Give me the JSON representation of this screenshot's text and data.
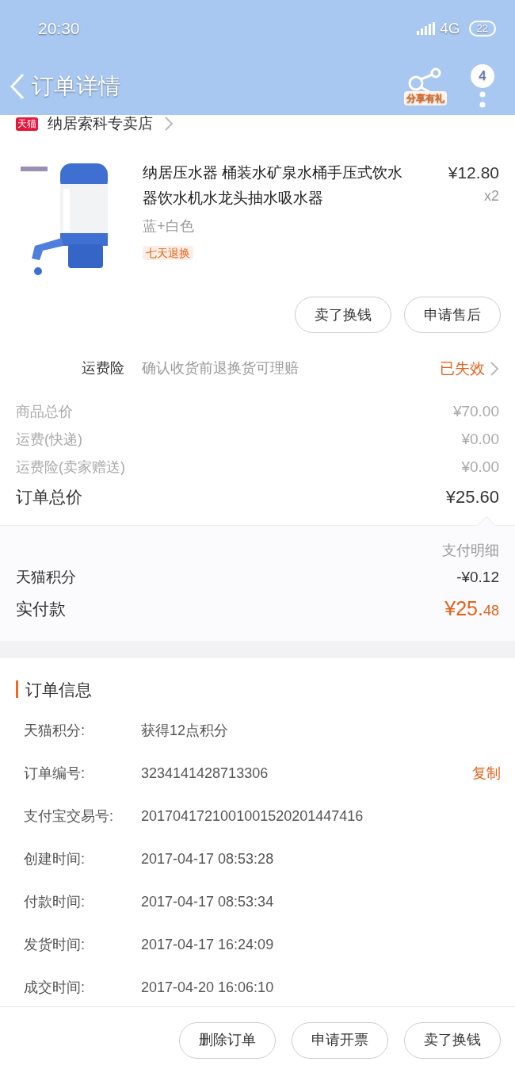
{
  "status_bar": {
    "time": "20:30",
    "network": "4G",
    "battery": "22"
  },
  "header": {
    "title": "订单详情",
    "share_label": "分享有礼",
    "badge": "4"
  },
  "shop": {
    "platform": "天猫",
    "name": "纳居索科专卖店"
  },
  "product": {
    "kind": "picture",
    "title": "纳居压水器 桶装水矿泉水桶手压式饮水器饮水机水龙头抽水吸水器",
    "variant": "蓝+白色",
    "tag": "七天退换",
    "price": "¥12.80",
    "quantity": "x2"
  },
  "item_actions": [
    "卖了换钱",
    "申请售后"
  ],
  "insurance": {
    "label": "运费险",
    "description": "确认收货前退换货可理赔",
    "status": "已失效"
  },
  "price_lines": [
    {
      "label": "商品总价",
      "value": "¥70.00"
    },
    {
      "label": "运费(快递)",
      "value": "¥0.00"
    },
    {
      "label": "运费险(卖家赠送)",
      "value": "¥0.00"
    }
  ],
  "order_total": {
    "label": "订单总价",
    "value": "¥25.60"
  },
  "payment": {
    "detail_link": "支付明细",
    "points_label": "天猫积分",
    "points_value": "-¥0.12",
    "paid_label": "实付款",
    "paid_value": "¥25.48"
  },
  "order_info": {
    "title": "订单信息",
    "copy": "复制",
    "rows": [
      {
        "label": "天猫积分:",
        "value": "获得12点积分",
        "copy": false
      },
      {
        "label": "订单编号:",
        "value": "3234141428713306",
        "copy": true
      },
      {
        "label": "支付宝交易号:",
        "value": "2017041721001001520201447416",
        "copy": false
      },
      {
        "label": "创建时间:",
        "value": "2017-04-17 08:53:28",
        "copy": false
      },
      {
        "label": "付款时间:",
        "value": "2017-04-17 08:53:34",
        "copy": false
      },
      {
        "label": "发货时间:",
        "value": "2017-04-17 16:24:09",
        "copy": false
      },
      {
        "label": "成交时间:",
        "value": "2017-04-20 16:06:10",
        "copy": false
      }
    ]
  },
  "bottom_actions": [
    "删除订单",
    "申请开票",
    "卖了换钱"
  ]
}
